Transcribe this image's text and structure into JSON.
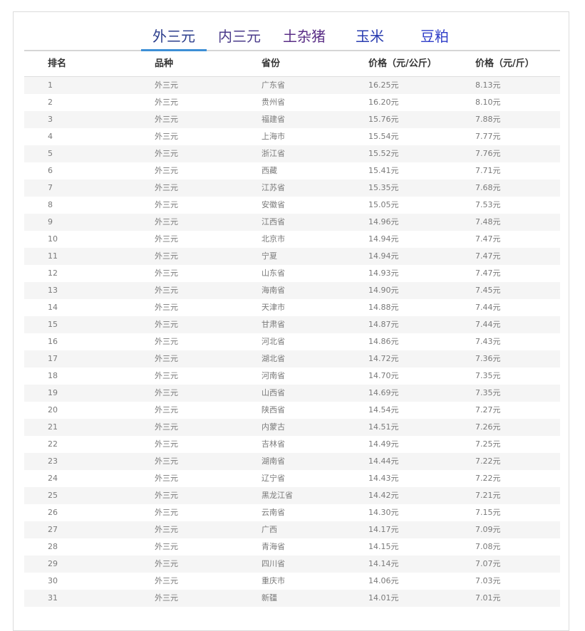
{
  "tabs": [
    {
      "label": "外三元",
      "color": "#2b3d8c",
      "active": true
    },
    {
      "label": "内三元",
      "color": "#4a3a8a",
      "active": false
    },
    {
      "label": "土杂猪",
      "color": "#5a2e86",
      "active": false
    },
    {
      "label": "玉米",
      "color": "#2a3db0",
      "active": false
    },
    {
      "label": "豆粕",
      "color": "#2e3cc8",
      "active": false
    }
  ],
  "colors": {
    "accent": "#3d8fd6",
    "row_alt": "#f5f5f5",
    "header_text": "#333333",
    "cell_text": "#7a7a7a"
  },
  "table": {
    "headers": [
      "排名",
      "品种",
      "省份",
      "价格（元/公斤）",
      "价格（元/斤）"
    ],
    "rows": [
      [
        "1",
        "外三元",
        "广东省",
        "16.25元",
        "8.13元"
      ],
      [
        "2",
        "外三元",
        "贵州省",
        "16.20元",
        "8.10元"
      ],
      [
        "3",
        "外三元",
        "福建省",
        "15.76元",
        "7.88元"
      ],
      [
        "4",
        "外三元",
        "上海市",
        "15.54元",
        "7.77元"
      ],
      [
        "5",
        "外三元",
        "浙江省",
        "15.52元",
        "7.76元"
      ],
      [
        "6",
        "外三元",
        "西藏",
        "15.41元",
        "7.71元"
      ],
      [
        "7",
        "外三元",
        "江苏省",
        "15.35元",
        "7.68元"
      ],
      [
        "8",
        "外三元",
        "安徽省",
        "15.05元",
        "7.53元"
      ],
      [
        "9",
        "外三元",
        "江西省",
        "14.96元",
        "7.48元"
      ],
      [
        "10",
        "外三元",
        "北京市",
        "14.94元",
        "7.47元"
      ],
      [
        "11",
        "外三元",
        "宁夏",
        "14.94元",
        "7.47元"
      ],
      [
        "12",
        "外三元",
        "山东省",
        "14.93元",
        "7.47元"
      ],
      [
        "13",
        "外三元",
        "海南省",
        "14.90元",
        "7.45元"
      ],
      [
        "14",
        "外三元",
        "天津市",
        "14.88元",
        "7.44元"
      ],
      [
        "15",
        "外三元",
        "甘肃省",
        "14.87元",
        "7.44元"
      ],
      [
        "16",
        "外三元",
        "河北省",
        "14.86元",
        "7.43元"
      ],
      [
        "17",
        "外三元",
        "湖北省",
        "14.72元",
        "7.36元"
      ],
      [
        "18",
        "外三元",
        "河南省",
        "14.70元",
        "7.35元"
      ],
      [
        "19",
        "外三元",
        "山西省",
        "14.69元",
        "7.35元"
      ],
      [
        "20",
        "外三元",
        "陕西省",
        "14.54元",
        "7.27元"
      ],
      [
        "21",
        "外三元",
        "内蒙古",
        "14.51元",
        "7.26元"
      ],
      [
        "22",
        "外三元",
        "吉林省",
        "14.49元",
        "7.25元"
      ],
      [
        "23",
        "外三元",
        "湖南省",
        "14.44元",
        "7.22元"
      ],
      [
        "24",
        "外三元",
        "辽宁省",
        "14.43元",
        "7.22元"
      ],
      [
        "25",
        "外三元",
        "黑龙江省",
        "14.42元",
        "7.21元"
      ],
      [
        "26",
        "外三元",
        "云南省",
        "14.30元",
        "7.15元"
      ],
      [
        "27",
        "外三元",
        "广西",
        "14.17元",
        "7.09元"
      ],
      [
        "28",
        "外三元",
        "青海省",
        "14.15元",
        "7.08元"
      ],
      [
        "29",
        "外三元",
        "四川省",
        "14.14元",
        "7.07元"
      ],
      [
        "30",
        "外三元",
        "重庆市",
        "14.06元",
        "7.03元"
      ],
      [
        "31",
        "外三元",
        "新疆",
        "14.01元",
        "7.01元"
      ]
    ]
  }
}
